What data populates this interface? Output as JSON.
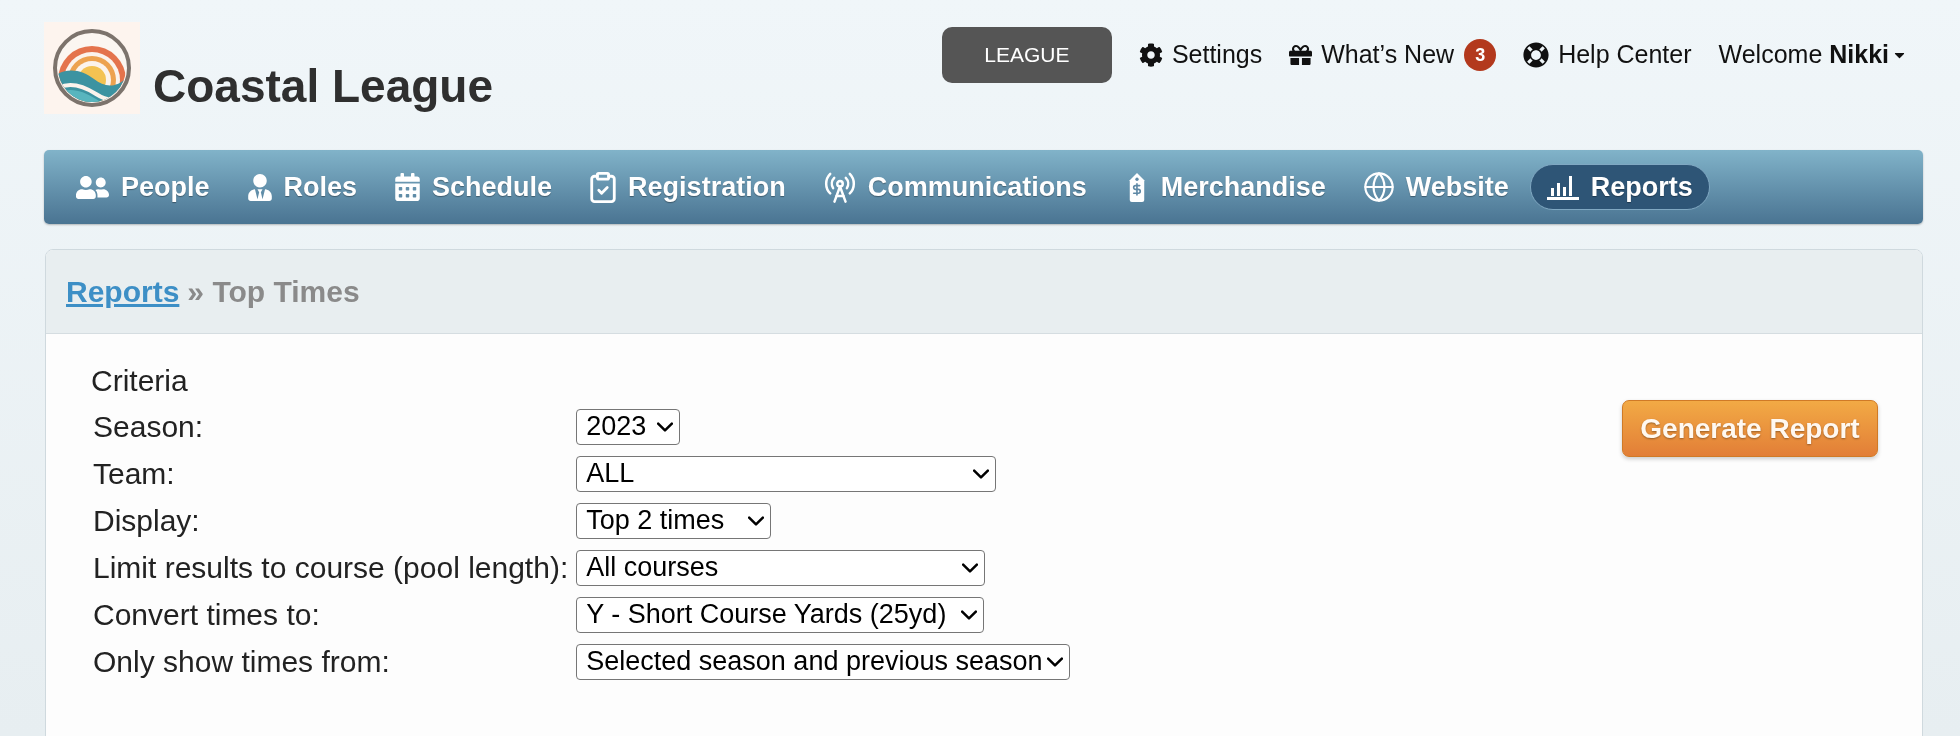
{
  "header": {
    "title": "Coastal League",
    "league_button": "LEAGUE",
    "links": [
      {
        "kind": "settings",
        "label": "Settings"
      },
      {
        "kind": "whats_new",
        "label": "What’s New",
        "badge": "3"
      },
      {
        "kind": "help",
        "label": "Help Center"
      }
    ],
    "user_menu": "Welcome **Nikki**"
  },
  "nav": {
    "items": [
      {
        "kind": "people",
        "label": "People",
        "selected": false
      },
      {
        "kind": "roles",
        "label": "Roles",
        "selected": false
      },
      {
        "kind": "schedule",
        "label": "Schedule",
        "selected": false
      },
      {
        "kind": "registration",
        "label": "Registration",
        "selected": false
      },
      {
        "kind": "communications",
        "label": "Communications",
        "selected": false
      },
      {
        "kind": "merchandise",
        "label": "Merchandise",
        "selected": false
      },
      {
        "kind": "website",
        "label": "Website",
        "selected": false
      },
      {
        "kind": "reports",
        "label": "Reports",
        "selected": true
      }
    ]
  },
  "breadcrumb": {
    "link": "Reports",
    "current": "» Top Times"
  },
  "criteria": {
    "title": "Criteria",
    "fields": [
      {
        "label": "Season:",
        "value": "2023"
      },
      {
        "label": "Team:",
        "value": "ALL"
      },
      {
        "label": "Display:",
        "value": "Top 2 times"
      },
      {
        "label": "Limit results to course (pool length):",
        "value": "All courses"
      },
      {
        "label": "Convert times to:",
        "value": "Y - Short Course Yards (25yd)"
      },
      {
        "label": "Only show times from:",
        "value": "Selected season and previous season"
      }
    ]
  },
  "generate_button": "Generate Report"
}
